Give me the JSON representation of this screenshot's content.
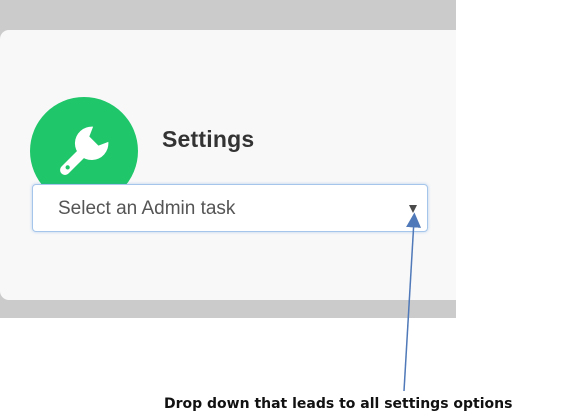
{
  "settings": {
    "title": "Settings",
    "icon": "wrench-icon",
    "accent_color": "#1fc76a"
  },
  "admin_dropdown": {
    "selected": "Select an Admin task"
  },
  "annotation": {
    "text": "Drop down that leads to all settings options",
    "arrow_color": "#4f79b8"
  }
}
